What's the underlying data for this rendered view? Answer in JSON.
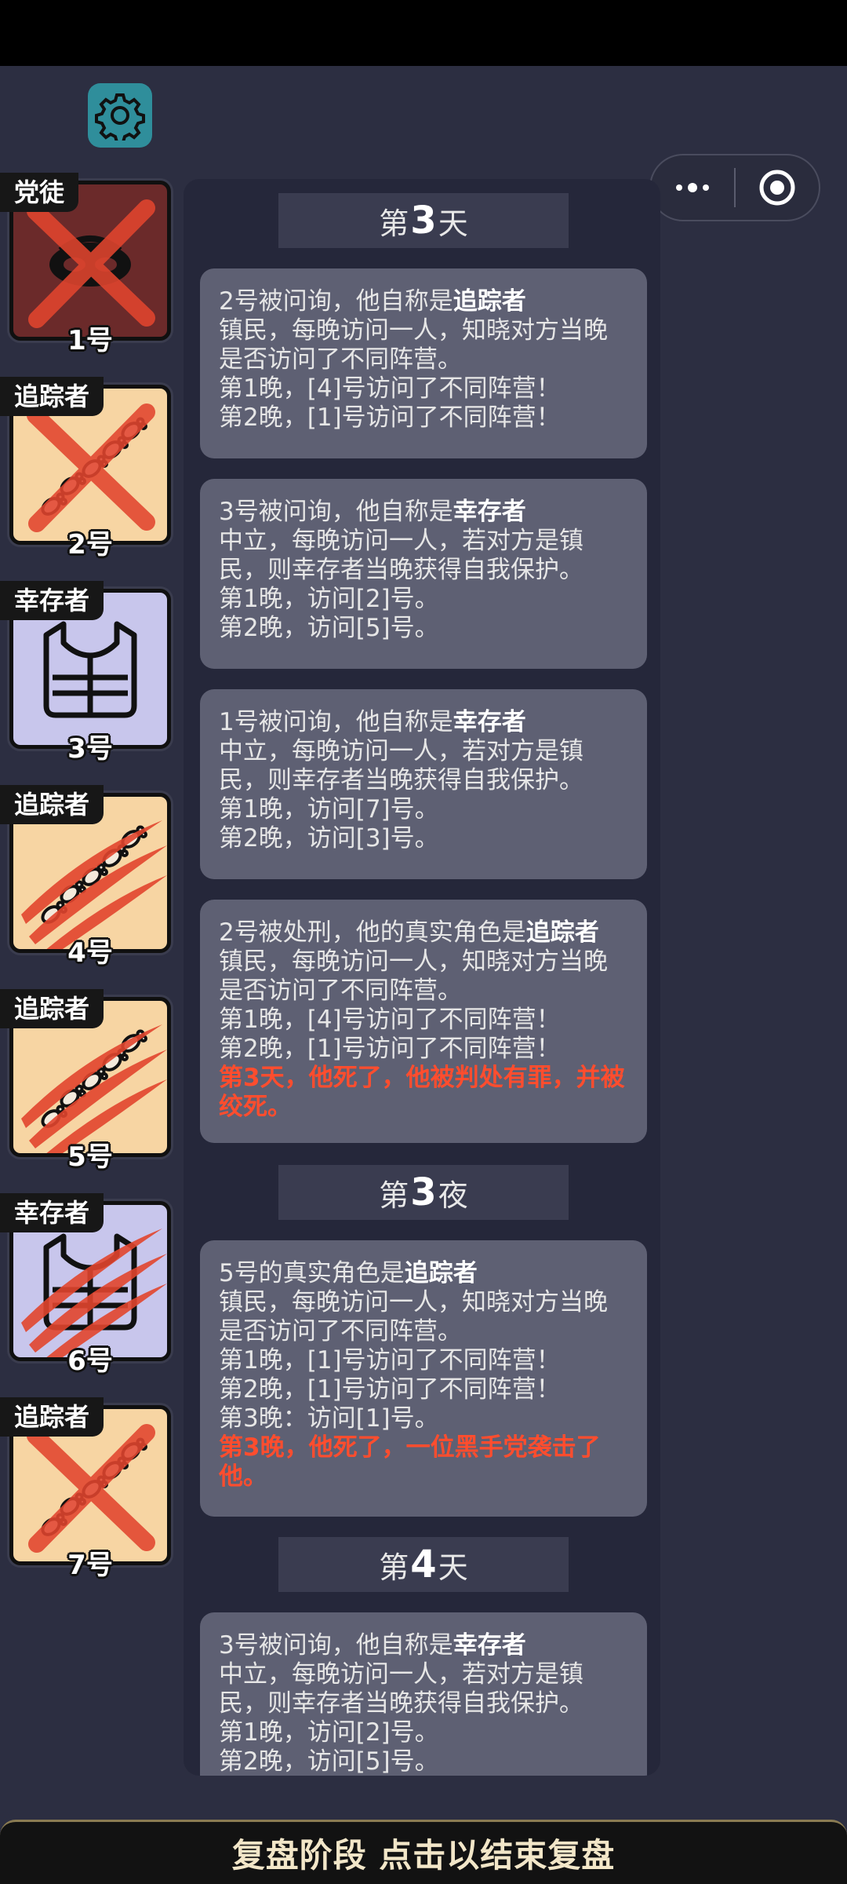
{
  "players": [
    {
      "number": "1号",
      "role": "党徒",
      "art": "mask",
      "mark": "cross",
      "bg": "#6b2a2a"
    },
    {
      "number": "2号",
      "role": "追踪者",
      "art": "footprints",
      "mark": "cross",
      "bg": "#f7d5a3"
    },
    {
      "number": "3号",
      "role": "幸存者",
      "art": "vest",
      "mark": "none",
      "bg": "#c8c6ec"
    },
    {
      "number": "4号",
      "role": "追踪者",
      "art": "footprints",
      "mark": "claw",
      "bg": "#f7d5a3"
    },
    {
      "number": "5号",
      "role": "追踪者",
      "art": "footprints",
      "mark": "claw",
      "bg": "#f7d5a3"
    },
    {
      "number": "6号",
      "role": "幸存者",
      "art": "vest",
      "mark": "claw",
      "bg": "#c8c6ec"
    },
    {
      "number": "7号",
      "role": "追踪者",
      "art": "footprints",
      "mark": "cross",
      "bg": "#f7d5a3"
    }
  ],
  "log": {
    "headings": [
      {
        "prefix": "第",
        "num": "3",
        "suffix": "天"
      },
      {
        "prefix": "第",
        "num": "3",
        "suffix": "夜"
      },
      {
        "prefix": "第",
        "num": "4",
        "suffix": "天"
      }
    ],
    "entries": [
      {
        "first_prefix": "2号被问询，他自称是",
        "role_name": "追踪者",
        "lines": [
          "镇民，每晚访问一人，知晓对方当晚",
          "是否访问了不同阵营。",
          "第1晚，[4]号访问了不同阵营！",
          "第2晚，[1]号访问了不同阵营！"
        ]
      },
      {
        "first_prefix": "3号被问询，他自称是",
        "role_name": "幸存者",
        "lines": [
          "中立，每晚访问一人，若对方是镇",
          "民，则幸存者当晚获得自我保护。",
          "第1晚，访问[2]号。",
          "第2晚，访问[5]号。"
        ]
      },
      {
        "first_prefix": "1号被问询，他自称是",
        "role_name": "幸存者",
        "lines": [
          "中立，每晚访问一人，若对方是镇",
          "民，则幸存者当晚获得自我保护。",
          "第1晚，访问[7]号。",
          "第2晚，访问[3]号。"
        ]
      },
      {
        "first_prefix": "2号被处刑，他的真实角色是",
        "role_name": "追踪者",
        "lines": [
          "镇民，每晚访问一人，知晓对方当晚",
          "是否访问了不同阵营。",
          "第1晚，[4]号访问了不同阵营！",
          "第2晚，[1]号访问了不同阵营！"
        ],
        "death": "第3天，他死了，他被判处有罪，并被绞死。"
      },
      {
        "first_prefix": "5号的真实角色是",
        "role_name": "追踪者",
        "lines": [
          "镇民，每晚访问一人，知晓对方当晚",
          "是否访问了不同阵营。",
          "第1晚，[1]号访问了不同阵营！",
          "第2晚，[1]号访问了不同阵营！",
          "第3晚：访问[1]号。"
        ],
        "death": "第3晚，他死了，一位黑手党袭击了他。"
      },
      {
        "first_prefix": "3号被问询，他自称是",
        "role_name": "幸存者",
        "lines": [
          "中立，每晚访问一人，若对方是镇",
          "民，则幸存者当晚获得自我保护。",
          "第1晚，访问[2]号。",
          "第2晚，访问[5]号。"
        ]
      }
    ]
  },
  "bottom_bar": {
    "label": "复盘阶段 点击以结束复盘"
  },
  "icons": {
    "settings": "gear-icon",
    "more": "more-icon",
    "close": "target-icon"
  },
  "colors": {
    "accent": "#2f8e9b",
    "death_text": "#ff4d2e",
    "entry_bg": "#5e6073"
  }
}
